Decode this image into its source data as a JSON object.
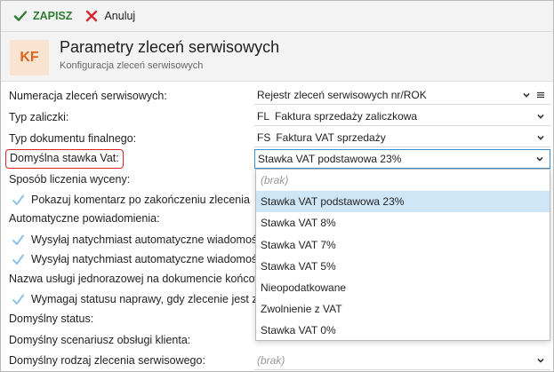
{
  "toolbar": {
    "save_label": "ZAPISZ",
    "cancel_label": "Anuluj"
  },
  "header": {
    "badge": "KF",
    "title": "Parametry zleceń serwisowych",
    "subtitle": "Konfiguracja zleceń serwisowych"
  },
  "form": {
    "numeracja_label": "Numeracja zleceń serwisowych:",
    "numeracja_value": "Rejestr zleceń serwisowych nr/ROK",
    "typ_zaliczki_label": "Typ zaliczki:",
    "typ_zaliczki_code": "FL",
    "typ_zaliczki_value": "Faktura sprzedaży zaliczkowa",
    "typ_dok_label": "Typ dokumentu finalnego:",
    "typ_dok_code": "FS",
    "typ_dok_value": "Faktura VAT sprzedaży",
    "stawka_label": "Domyślna stawka Vat:",
    "stawka_value": "Stawka VAT podstawowa 23%",
    "sposob_label": "Sposób liczenia wyceny:",
    "pokazuj_label": "Pokazuj komentarz po zakończeniu zlecenia",
    "auto_label": "Automatyczne powiadomienia:",
    "wysylaj_email_label": "Wysyłaj natychmiast automatyczne wiadomości e-m",
    "wysylaj_sms_label": "Wysyłaj natychmiast automatyczne wiadomości SMS",
    "nazwa_uslugi_label": "Nazwa usługi jednorazowej na dokumencie końcowym:",
    "wymagaj_label": "Wymagaj statusu naprawy, gdy zlecenie jest zakońc",
    "status_label": "Domyślny status:",
    "scenariusz_label": "Domyślny scenariusz obsługi klienta:",
    "rodzaj_label": "Domyślny rodzaj zlecenia serwisowego:",
    "rodzaj_placeholder": "(brak)"
  },
  "dropdown": {
    "items": [
      "(brak)",
      "Stawka VAT podstawowa 23%",
      "Stawka VAT 8%",
      "Stawka VAT 7%",
      "Stawka VAT 5%",
      "Nieopodatkowane",
      "Zwolnienie z VAT",
      "Stawka VAT 0%"
    ],
    "selected_index": 1
  },
  "colors": {
    "accent": "#3d8fd1",
    "save_green": "#2e7d32",
    "cancel_red": "#d6262b",
    "badge_bg": "#fbe3d2",
    "badge_fg": "#d9661f",
    "selected_bg": "#cfe6f7"
  },
  "icons": {
    "save": "check-icon",
    "cancel": "x-icon",
    "chevron": "chevron-down-icon",
    "menu": "hamburger-icon",
    "checkbox": "checkbox-checked-icon"
  }
}
